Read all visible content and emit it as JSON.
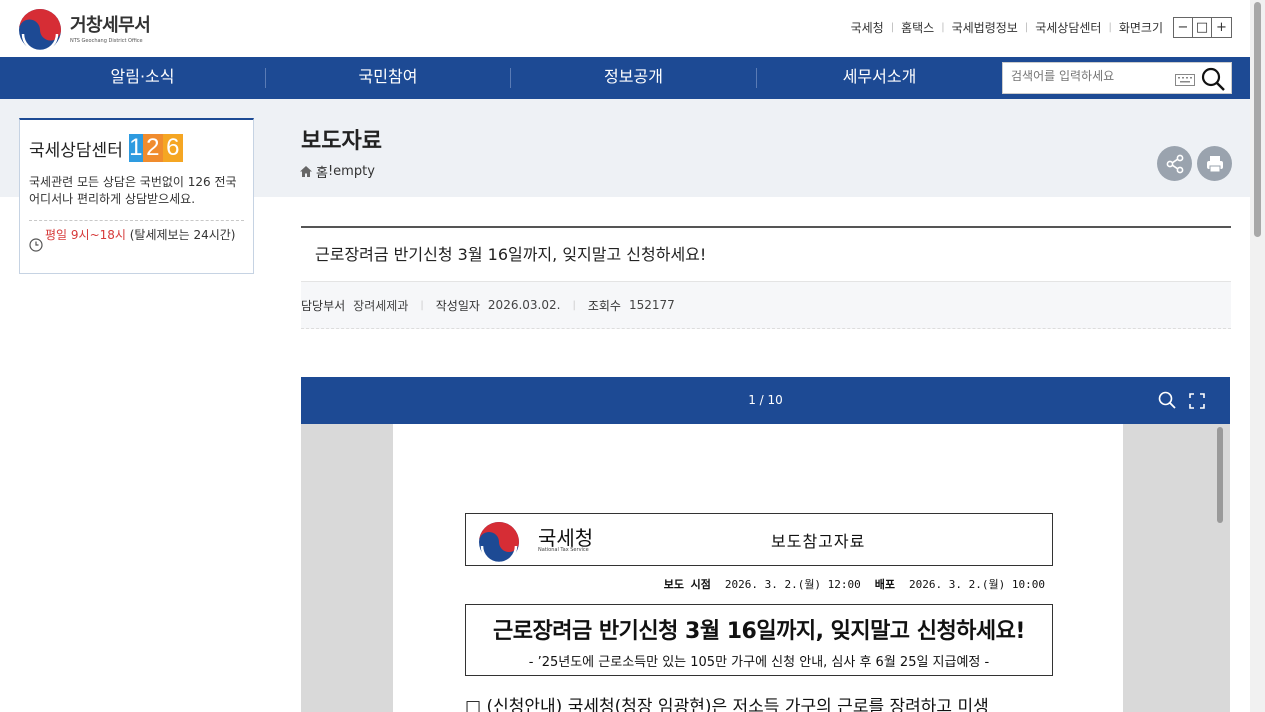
{
  "header": {
    "logo_title": "거창세무서",
    "logo_subtitle": "NTS Geochang District Office",
    "util_links": [
      "국세청",
      "홈택스",
      "국세법령정보",
      "국세상담센터"
    ],
    "zoom_label": "화면크기",
    "zoom_buttons": [
      "−",
      "□",
      "+"
    ]
  },
  "nav": {
    "items": [
      "알림·소식",
      "국민참여",
      "정보공개",
      "세무서소개"
    ],
    "search_placeholder": "검색어를 입력하세요"
  },
  "consult": {
    "title": "국세상담센터",
    "number": [
      "1",
      "2",
      "6"
    ],
    "desc": "국세관련 모든 상담은 국번없이 126 전국 어디서나 편리하게 상담받으세요.",
    "hours_red": "평일 9시~18시",
    "hours_rest": " (탈세제보는 24시간)"
  },
  "page": {
    "title": "보도자료",
    "breadcrumb_home": "홈",
    "breadcrumb_rest": "!empty"
  },
  "article": {
    "title": "근로장려금 반기신청 3월 16일까지, 잊지말고 신청하세요!",
    "dept_label": "담당부서",
    "dept_value": "장려세제과",
    "date_label": "작성일자",
    "date_value": "2026.03.02.",
    "views_label": "조회수",
    "views_value": "152177"
  },
  "viewer": {
    "page_counter": "1 / 10",
    "org_name": "국세청",
    "org_sub": "National Tax Service",
    "doc_type": "보도참고자료",
    "release_label": "보도 시점",
    "release_value": "2026. 3. 2.(월) 12:00",
    "distribute_label": "배포",
    "distribute_value": "2026. 3. 2.(월) 10:00",
    "headline": "근로장려금 반기신청 3월 16일까지, 잊지말고 신청하세요!",
    "subhead": "- ’25년도에 근로소득만 있는 105만 가구에 신청 안내, 심사 후 6월 25일 지급예정 -",
    "body_first_line": "□ (신청안내) 국세청(청장 임광현)은 저소득 가구의 근로를 장려하고 미생"
  },
  "colors": {
    "brand_blue": "#1d4a94",
    "band_grey": "#eef1f5",
    "hours_red": "#d63a3a",
    "num1": "#2e9be0",
    "num2": "#f08c2e",
    "num6": "#f5a623"
  }
}
